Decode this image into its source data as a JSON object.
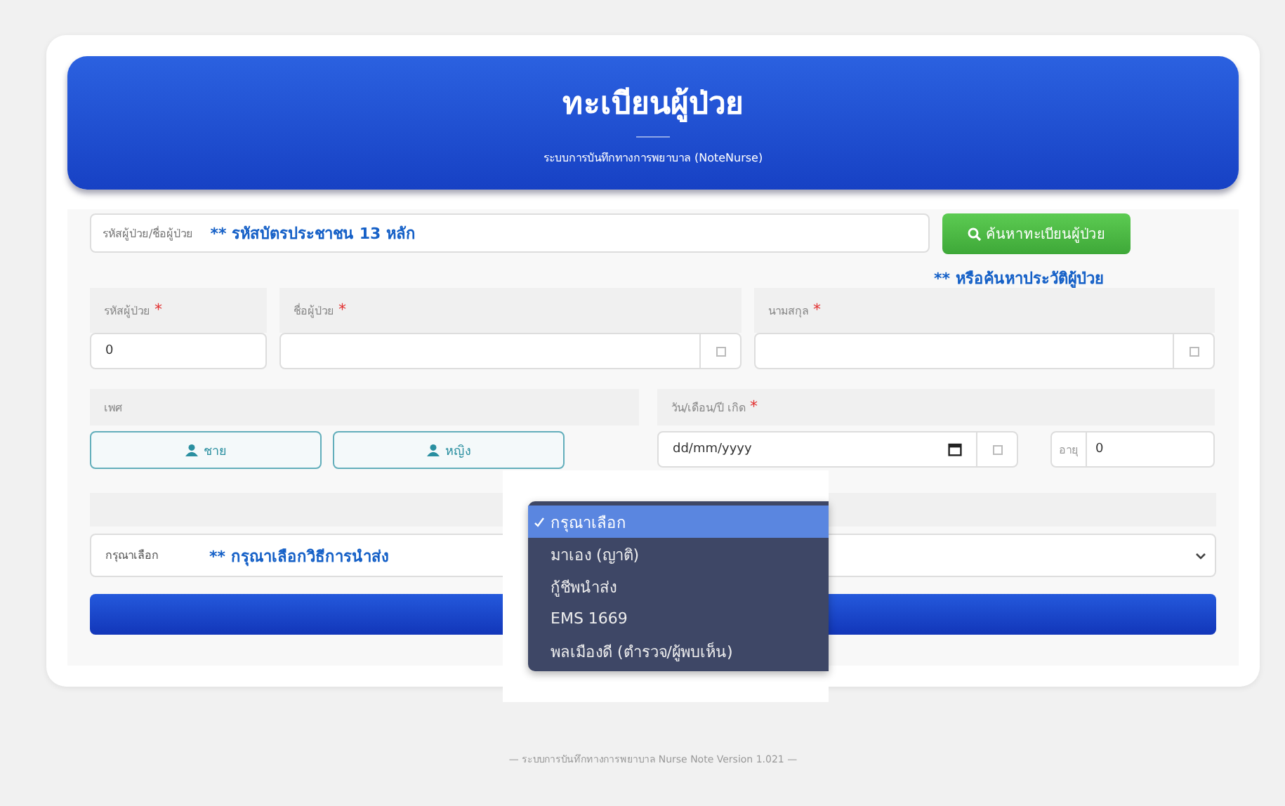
{
  "header": {
    "title": "ทะเบียนผู้ป่วย",
    "subtitle": "ระบบการบันทึกทางการพยาบาล (NoteNurse)"
  },
  "search": {
    "placeholder": "รหัสผู้ป่วย/ชื่อผู้ป่วย",
    "hint": "** รหัสบัตรประชาชน 13 หลัก",
    "button": "ค้นหาทะเบียนผู้ป่วย",
    "note": "** หรือค้นหาประวัติผู้ป่วย"
  },
  "fields": [
    {
      "label": "รหัสผู้ป่วย",
      "required_mark": "*",
      "value": "0",
      "addon": false
    },
    {
      "label": "ชื่อผู้ป่วย",
      "required_mark": "*",
      "addon": true
    },
    {
      "label": "นามสกุล",
      "required_mark": "*",
      "addon": true
    }
  ],
  "gender": {
    "label": "เพศ",
    "options": [
      "ชาย",
      "หญิง"
    ]
  },
  "birth": {
    "label": "วัน/เดือน/ปี เกิด",
    "required_mark": "*",
    "placeholder": "dd/mm/yyyy",
    "age_label": "อายุ",
    "age_value": "0"
  },
  "transport": {
    "value": "กรุณาเลือก",
    "hint": "** กรุณาเลือกวิธีการนำส่ง",
    "options": [
      {
        "label": "กรุณาเลือก",
        "selected": true
      },
      {
        "label": "มาเอง (ญาติ)",
        "selected": false
      },
      {
        "label": "กู้ชีพนำส่ง",
        "selected": false
      },
      {
        "label": "EMS 1669",
        "selected": false
      },
      {
        "label": "พลเมืองดี (ตำรวจ/ผู้พบเห็น)",
        "selected": false
      }
    ]
  },
  "footer": "— ระบบการบันทึกทางการพยาบาล Nurse Note Version 1.021 —"
}
